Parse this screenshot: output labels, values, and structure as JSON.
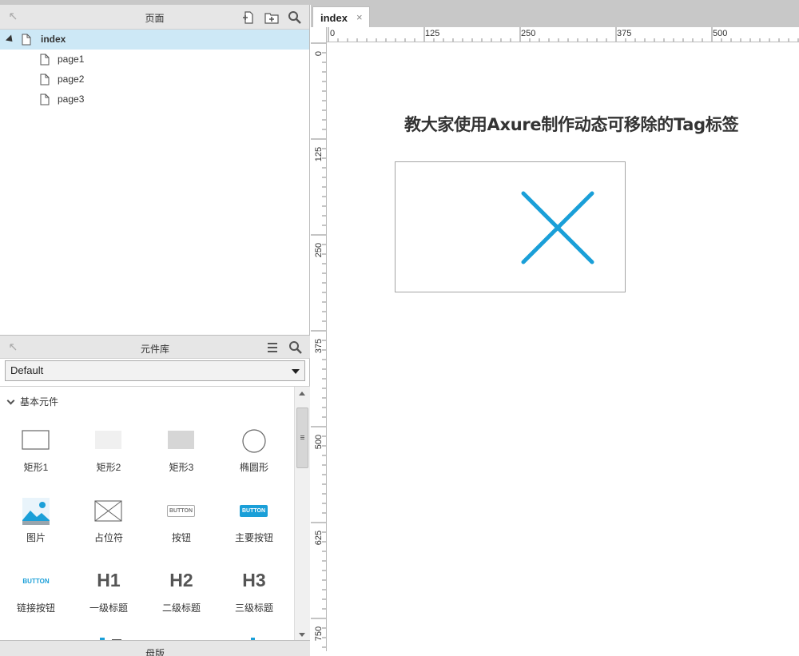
{
  "pages_panel": {
    "title": "页面",
    "tree": [
      {
        "label": "index",
        "selected": true,
        "expanded": true,
        "level": 0
      },
      {
        "label": "page1",
        "level": 1
      },
      {
        "label": "page2",
        "level": 1
      },
      {
        "label": "page3",
        "level": 1
      }
    ],
    "icons": [
      "pin-icon",
      "add-page-icon",
      "add-folder-icon",
      "search-icon"
    ]
  },
  "library_panel": {
    "title": "元件库",
    "selected_library": "Default",
    "category": "基本元件",
    "widgets": [
      {
        "label": "矩形1",
        "icon": "rectangle-outline-icon"
      },
      {
        "label": "矩形2",
        "icon": "rectangle-light-icon"
      },
      {
        "label": "矩形3",
        "icon": "rectangle-gray-icon"
      },
      {
        "label": "椭圆形",
        "icon": "ellipse-icon"
      },
      {
        "label": "图片",
        "icon": "image-icon"
      },
      {
        "label": "占位符",
        "icon": "placeholder-icon"
      },
      {
        "label": "按钮",
        "icon": "button-icon",
        "text": "BUTTON"
      },
      {
        "label": "主要按钮",
        "icon": "primary-button-icon",
        "text": "BUTTON"
      },
      {
        "label": "链接按钮",
        "icon": "link-button-icon",
        "text": "BUTTON"
      },
      {
        "label": "一级标题",
        "icon": "h1-icon",
        "text": "H1"
      },
      {
        "label": "二级标题",
        "icon": "h2-icon",
        "text": "H2"
      },
      {
        "label": "三级标题",
        "icon": "h3-icon",
        "text": "H3"
      }
    ]
  },
  "bottom_panel": {
    "title": "母版"
  },
  "editor": {
    "tab_label": "index",
    "tab_close": "×",
    "hruler_labels": [
      "0",
      "125",
      "250",
      "375",
      "500"
    ],
    "vruler_labels": [
      "0",
      "125",
      "250",
      "375",
      "500",
      "625",
      "750"
    ],
    "canvas_heading": "教大家使用Axure制作动态可移除的Tag标签"
  },
  "colors": {
    "accent": "#1a9fd8",
    "selected_row": "#cde8f6",
    "panel_header": "#e6e6e6"
  }
}
